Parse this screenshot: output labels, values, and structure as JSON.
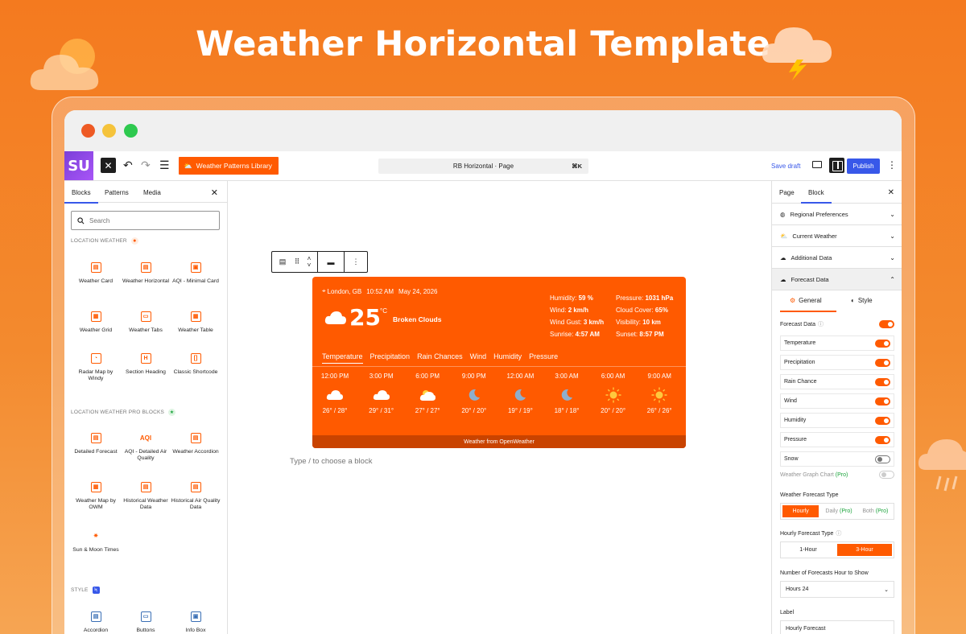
{
  "hero": {
    "title": "Weather Horizontal Template"
  },
  "topbar": {
    "logo": "SU",
    "library_button": "Weather Patterns Library",
    "command": "RB Horizontal · Page",
    "command_shortcut": "⌘K",
    "save_draft": "Save draft",
    "publish": "Publish"
  },
  "inserter": {
    "tabs": [
      "Blocks",
      "Patterns",
      "Media"
    ],
    "search_placeholder": "Search",
    "section1": "LOCATION WEATHER",
    "section1_blocks": [
      "Weather Card",
      "Weather Horizontal",
      "AQI - Minimal Card",
      "Weather Grid",
      "Weather Tabs",
      "Weather Table",
      "Radar Map by Windy",
      "Section Heading",
      "Classic Shortcode"
    ],
    "section2": "LOCATION WEATHER PRO BLOCKS",
    "section2_blocks": [
      "Detailed Forecast",
      "AQI - Detailed Air Quality",
      "Weather Accordion",
      "Weather Map by OWM",
      "Historical Weather Data",
      "Historical Air Quality Data",
      "Sun & Moon Times"
    ],
    "section3": "STYLE",
    "section3_blocks": [
      "Accordion",
      "Buttons",
      "Info Box"
    ]
  },
  "weather": {
    "location": "London, GB",
    "time": "10:52 AM",
    "date": "May 24, 2026",
    "temp": "25",
    "unit": "°C",
    "condition": "Broken Clouds",
    "stats_left": [
      {
        "label": "Humidity:",
        "value": "59 %"
      },
      {
        "label": "Wind:",
        "value": "2 km/h"
      },
      {
        "label": "Wind Gust:",
        "value": "3 km/h"
      },
      {
        "label": "Sunrise:",
        "value": "4:57 AM"
      }
    ],
    "stats_right": [
      {
        "label": "Pressure:",
        "value": "1031 hPa"
      },
      {
        "label": "Cloud Cover:",
        "value": "65%"
      },
      {
        "label": "Visibility:",
        "value": "10 km"
      },
      {
        "label": "Sunset:",
        "value": "8:57 PM"
      }
    ],
    "tabs": [
      "Temperature",
      "Precipitation",
      "Rain Chances",
      "Wind",
      "Humidity",
      "Pressure"
    ],
    "hours": [
      {
        "time": "12:00 PM",
        "icon": "cloud-icon",
        "range": "26° / 28°"
      },
      {
        "time": "3:00 PM",
        "icon": "cloud-icon",
        "range": "29° / 31°"
      },
      {
        "time": "6:00 PM",
        "icon": "sun-cloud-icon",
        "range": "27° / 27°"
      },
      {
        "time": "9:00 PM",
        "icon": "moon-icon",
        "range": "20° / 20°"
      },
      {
        "time": "12:00 AM",
        "icon": "moon-icon",
        "range": "19° / 19°"
      },
      {
        "time": "3:00 AM",
        "icon": "moon-icon",
        "range": "18° / 18°"
      },
      {
        "time": "6:00 AM",
        "icon": "sun-icon",
        "range": "20° / 20°"
      },
      {
        "time": "9:00 AM",
        "icon": "sun-icon",
        "range": "26° / 26°"
      }
    ],
    "footer": "Weather from OpenWeather"
  },
  "canvas": {
    "placeholder": "Type / to choose a block"
  },
  "settings": {
    "tabs": [
      "Page",
      "Block"
    ],
    "panels": [
      "Regional Preferences",
      "Current Weather",
      "Additional Data",
      "Forecast Data"
    ],
    "subtabs": [
      "General",
      "Style"
    ],
    "forecast_data_label": "Forecast Data",
    "toggles": [
      {
        "label": "Temperature",
        "on": true
      },
      {
        "label": "Precipitation",
        "on": true
      },
      {
        "label": "Rain Chance",
        "on": true
      },
      {
        "label": "Wind",
        "on": true
      },
      {
        "label": "Humidity",
        "on": true
      },
      {
        "label": "Pressure",
        "on": true
      },
      {
        "label": "Snow",
        "on": false
      }
    ],
    "graph_chart": "Weather Graph Chart",
    "pro": "(Pro)",
    "forecast_type_label": "Weather Forecast Type",
    "forecast_types": [
      "Hourly",
      "Daily",
      "Both"
    ],
    "hourly_type_label": "Hourly Forecast Type",
    "hourly_types": [
      "1-Hour",
      "3-Hour"
    ],
    "hours_label": "Number of Forecasts Hour to Show",
    "hours_value": "Hours 24",
    "label_label": "Label",
    "label_value": "Hourly Forecast"
  },
  "colors": {
    "brand": "#ff5a00",
    "accent": "#3858e9"
  }
}
